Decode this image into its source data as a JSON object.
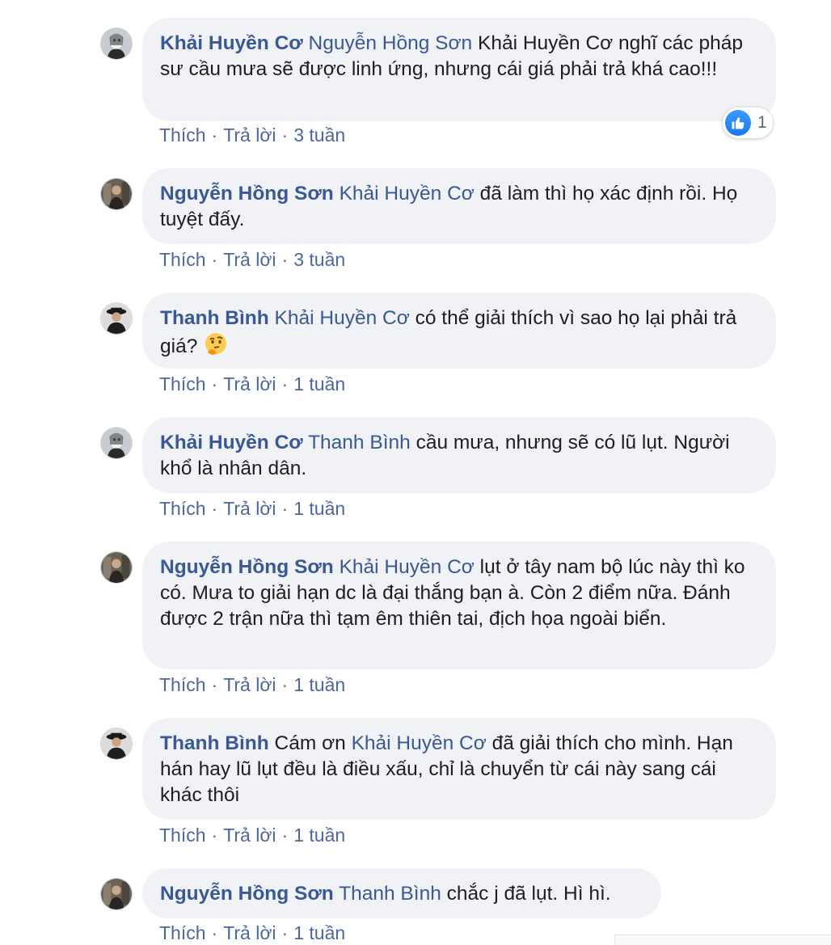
{
  "comments": [
    {
      "author": "Khải Huyền Cơ",
      "mention": "Nguyễn Hồng Sơn",
      "text": " Khải Huyền Cơ nghĩ các pháp sư cầu mưa sẽ được linh ứng, nhưng cái giá phải trả khá cao!!!",
      "like_label": "Thích",
      "reply_label": "Trả lời",
      "time": "3 tuần",
      "reaction_count": "1",
      "reaction_icon": "like-icon"
    },
    {
      "author": "Nguyễn Hồng Sơn",
      "mention": "Khải Huyền Cơ",
      "text": " đã làm thì họ xác định rồi. Họ tuyệt đấy.",
      "like_label": "Thích",
      "reply_label": "Trả lời",
      "time": "3 tuần"
    },
    {
      "author": "Thanh Bình",
      "mention": "Khải Huyền Cơ",
      "text": " có thể giải thích vì sao họ lại phải trả giá? ",
      "emoji": "thinking-face-emoji",
      "like_label": "Thích",
      "reply_label": "Trả lời",
      "time": "1 tuần"
    },
    {
      "author": "Khải Huyền Cơ",
      "mention": "Thanh Bình",
      "text": " cầu mưa, nhưng sẽ có lũ lụt. Người khổ là nhân dân.",
      "like_label": "Thích",
      "reply_label": "Trả lời",
      "time": "1 tuần"
    },
    {
      "author": "Nguyễn Hồng Sơn",
      "mention": "Khải Huyền Cơ",
      "text": " lụt ở tây nam bộ lúc này thì ko có. Mưa to giải hạn dc là đại thắng bạn à. Còn 2 điểm nữa. Đánh được 2 trận nữa thì tạm êm thiên tai, địch họa ngoài biển.",
      "like_label": "Thích",
      "reply_label": "Trả lời",
      "time": "1 tuần"
    },
    {
      "author": "Thanh Bình",
      "text_before": " Cám ơn ",
      "mention": "Khải Huyền Cơ",
      "text": " đã giải thích cho mình. Hạn hán hay lũ lụt đều là điều xấu, chỉ là chuyển từ cái này sang cái khác thôi",
      "like_label": "Thích",
      "reply_label": "Trả lời",
      "time": "1 tuần"
    },
    {
      "author": "Nguyễn Hồng Sơn",
      "mention": "Thanh Bình",
      "text": " chắc j đã lụt. Hì hì.",
      "like_label": "Thích",
      "reply_label": "Trả lời",
      "time": "1 tuần"
    }
  ],
  "separator": "·",
  "colors": {
    "author_link": "#385898",
    "bubble_bg": "#f0f2f5",
    "meta_text": "#616770",
    "like_blue": "#1877f2"
  }
}
